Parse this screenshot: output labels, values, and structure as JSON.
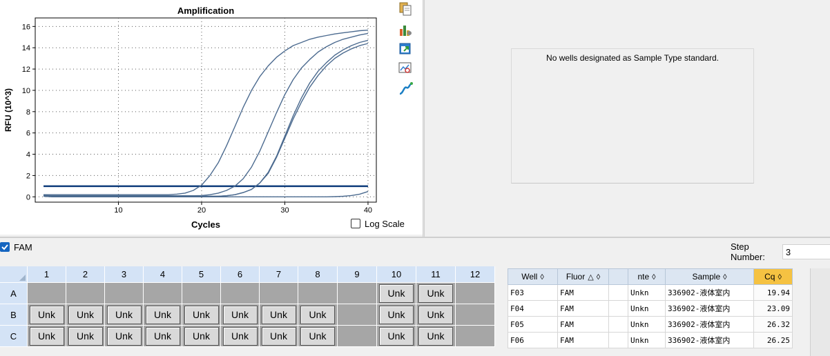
{
  "chart_data": {
    "type": "line",
    "title": "Amplification",
    "xlabel": "Cycles",
    "ylabel": "RFU (10^3)",
    "xlim": [
      0,
      41
    ],
    "ylim": [
      -0.5,
      16.8
    ],
    "xticks": [
      10,
      20,
      30,
      40
    ],
    "yticks": [
      0,
      2,
      4,
      6,
      8,
      10,
      12,
      14,
      16
    ],
    "grid": true,
    "x": [
      1,
      2,
      3,
      4,
      5,
      6,
      7,
      8,
      9,
      10,
      11,
      12,
      13,
      14,
      15,
      16,
      17,
      18,
      19,
      20,
      21,
      22,
      23,
      24,
      25,
      26,
      27,
      28,
      29,
      30,
      31,
      32,
      33,
      34,
      35,
      36,
      37,
      38,
      39,
      40
    ],
    "series": [
      {
        "values": [
          0.2,
          0.2,
          0.2,
          0.2,
          0.2,
          0.2,
          0.2,
          0.2,
          0.2,
          0.2,
          0.2,
          0.2,
          0.2,
          0.2,
          0.2,
          0.2,
          0.25,
          0.35,
          0.6,
          1.1,
          2.0,
          3.2,
          4.8,
          6.6,
          8.4,
          10.0,
          11.3,
          12.3,
          13.1,
          13.7,
          14.2,
          14.5,
          14.8,
          15.0,
          15.15,
          15.3,
          15.4,
          15.5,
          15.6,
          15.65
        ]
      },
      {
        "values": [
          0.15,
          0.1,
          0.1,
          0.1,
          0.1,
          0.1,
          0.1,
          0.1,
          0.1,
          0.1,
          0.1,
          0.1,
          0.1,
          0.1,
          0.1,
          0.1,
          0.1,
          0.1,
          0.1,
          0.12,
          0.2,
          0.35,
          0.6,
          1.0,
          1.7,
          2.8,
          4.3,
          6.1,
          7.9,
          9.6,
          11.0,
          12.1,
          12.9,
          13.6,
          14.1,
          14.5,
          14.8,
          15.0,
          15.2,
          15.35
        ]
      },
      {
        "values": [
          0.1,
          0.05,
          0.05,
          0.05,
          0.05,
          0.05,
          0.05,
          0.05,
          0.05,
          0.05,
          0.05,
          0.05,
          0.05,
          0.05,
          0.05,
          0.05,
          0.05,
          0.05,
          0.05,
          0.05,
          0.05,
          0.05,
          0.1,
          0.2,
          0.4,
          0.7,
          1.3,
          2.3,
          3.8,
          5.7,
          7.6,
          9.3,
          10.7,
          11.8,
          12.6,
          13.3,
          13.8,
          14.2,
          14.5,
          14.7
        ]
      },
      {
        "values": [
          0.1,
          0.05,
          0.05,
          0.05,
          0.05,
          0.05,
          0.05,
          0.05,
          0.05,
          0.05,
          0.05,
          0.05,
          0.05,
          0.05,
          0.05,
          0.05,
          0.05,
          0.05,
          0.05,
          0.05,
          0.05,
          0.05,
          0.1,
          0.2,
          0.4,
          0.7,
          1.3,
          2.2,
          3.7,
          5.5,
          7.3,
          8.9,
          10.3,
          11.4,
          12.3,
          13.0,
          13.5,
          13.9,
          14.2,
          14.4
        ]
      },
      {
        "values": [
          0.05,
          0.0,
          0.0,
          0.0,
          0.0,
          0.0,
          0.0,
          0.0,
          0.0,
          0.0,
          0.0,
          0.0,
          0.0,
          0.0,
          0.0,
          0.0,
          0.0,
          0.0,
          0.0,
          0.0,
          0.0,
          0.0,
          0.0,
          0.0,
          0.0,
          0.0,
          0.0,
          0.0,
          0.0,
          0.0,
          0.0,
          0.0,
          0.0,
          0.0,
          0.0,
          0.02,
          0.05,
          0.12,
          0.25,
          0.5
        ]
      }
    ],
    "threshold": 1.0
  },
  "colors": {
    "curve": "#4b6a8f",
    "threshold": "#0d3b7a",
    "plate_header": "#d4e3f6",
    "empty_well": "#a6a6a6",
    "cq_header": "#f5c242",
    "checkbox_checked": "#1565c0"
  },
  "toolbar": {
    "icons": [
      "copy-icon",
      "bar-chart-icon",
      "export-icon",
      "zoom-icon",
      "curve-icon"
    ]
  },
  "log_scale_label": "Log Scale",
  "standard_message": "No wells designated as Sample Type standard.",
  "fluor_checkbox": {
    "label": "FAM",
    "checked": true
  },
  "step_number": {
    "label": "Step Number:",
    "value": "3"
  },
  "plate": {
    "columns": [
      "1",
      "2",
      "3",
      "4",
      "5",
      "6",
      "7",
      "8",
      "9",
      "10",
      "11",
      "12"
    ],
    "rows": [
      {
        "label": "A",
        "wells": [
          "",
          "",
          "",
          "",
          "",
          "",
          "",
          "",
          "",
          "Unk",
          "Unk",
          ""
        ]
      },
      {
        "label": "B",
        "wells": [
          "Unk",
          "Unk",
          "Unk",
          "Unk",
          "Unk",
          "Unk",
          "Unk",
          "Unk",
          "",
          "Unk",
          "Unk",
          ""
        ]
      },
      {
        "label": "C",
        "wells": [
          "Unk",
          "Unk",
          "Unk",
          "Unk",
          "Unk",
          "Unk",
          "Unk",
          "Unk",
          "",
          "Unk",
          "Unk",
          ""
        ]
      }
    ]
  },
  "wells_table": {
    "headers": {
      "well": "Well",
      "fluor": "Fluor",
      "target": "",
      "content": "nte",
      "sample": "Sample",
      "cq": "Cq"
    },
    "sort_glyph": "◊",
    "sort_up_glyph": "△",
    "rows": [
      {
        "well": "F03",
        "fluor": "FAM",
        "target": "",
        "content": "Unkn",
        "sample": "336902-液体室内",
        "cq": "19.94"
      },
      {
        "well": "F04",
        "fluor": "FAM",
        "target": "",
        "content": "Unkn",
        "sample": "336902-液体室内",
        "cq": "23.09"
      },
      {
        "well": "F05",
        "fluor": "FAM",
        "target": "",
        "content": "Unkn",
        "sample": "336902-液体室内",
        "cq": "26.32"
      },
      {
        "well": "F06",
        "fluor": "FAM",
        "target": "",
        "content": "Unkn",
        "sample": "336902-液体室内",
        "cq": "26.25"
      }
    ]
  }
}
